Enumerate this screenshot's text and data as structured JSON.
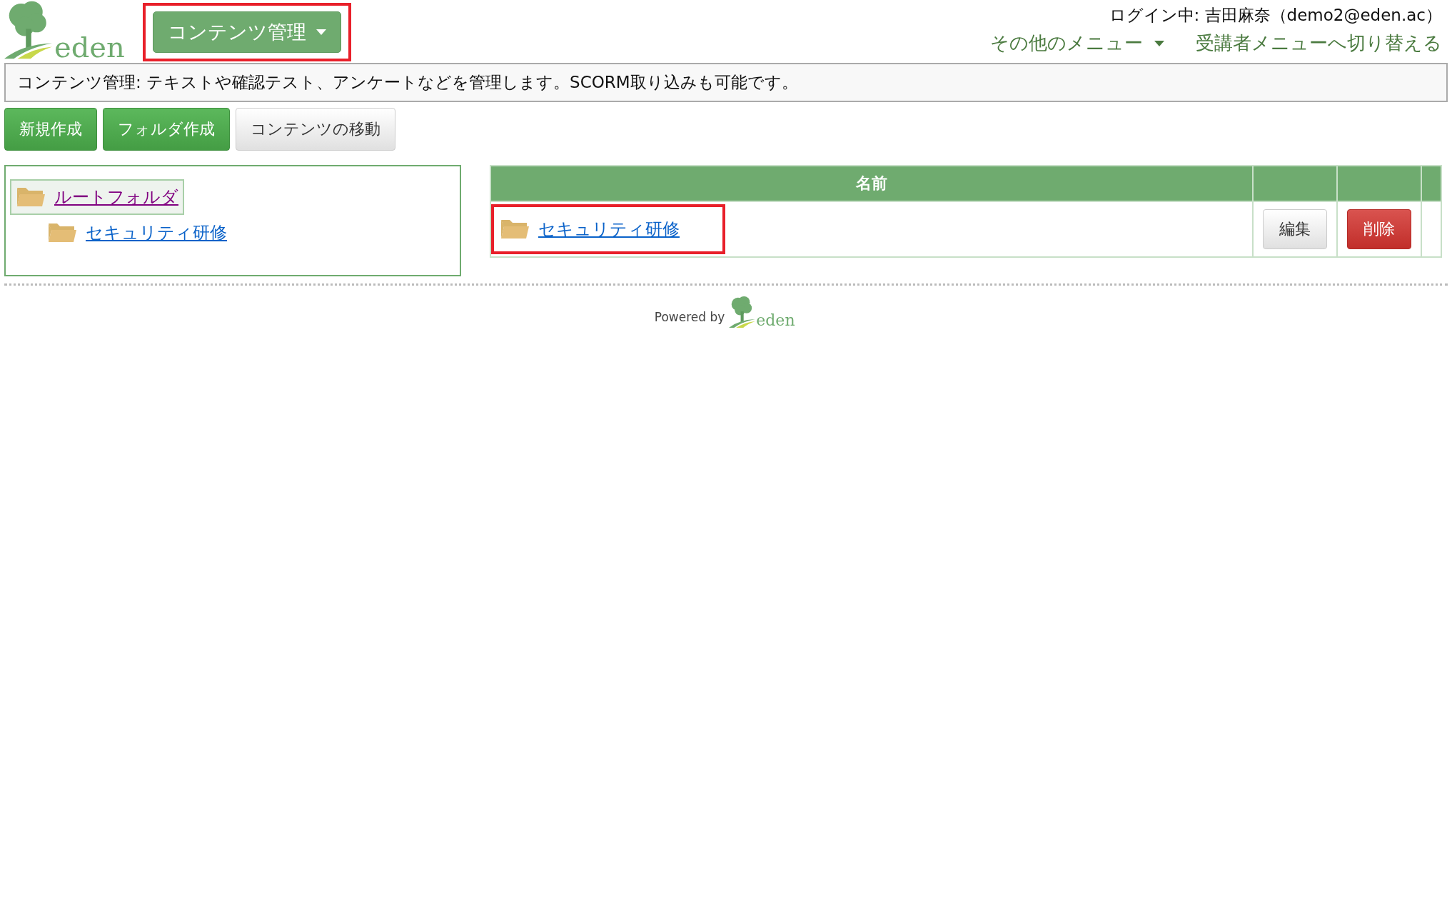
{
  "header": {
    "logo_text": "eden",
    "menu_button": {
      "label": "コンテンツ管理",
      "highlighted": true
    },
    "login": "ログイン中: 吉田麻奈（demo2@eden.ac）",
    "links": [
      {
        "label": "その他のメニュー",
        "dropdown": true
      },
      {
        "label": "受講者メニューへ切り替える",
        "dropdown": false
      }
    ]
  },
  "info": "コンテンツ管理: テキストや確認テスト、アンケートなどを管理します。SCORM取り込みも可能です。",
  "toolbar": [
    {
      "label": "新規作成",
      "kind": "primary"
    },
    {
      "label": "フォルダ作成",
      "kind": "primary"
    },
    {
      "label": "コンテンツの移動",
      "kind": "default"
    }
  ],
  "tree": [
    {
      "label": "ルートフォルダ",
      "selected": true,
      "visited": true,
      "children": [
        {
          "label": "セキュリティ研修",
          "selected": false,
          "visited": false
        }
      ]
    }
  ],
  "table": {
    "columns": [
      "名前",
      "",
      ""
    ],
    "rows": [
      {
        "name": "セキュリティ研修",
        "highlighted": true,
        "actions": [
          {
            "label": "編集",
            "kind": "default"
          },
          {
            "label": "削除",
            "kind": "danger"
          }
        ]
      }
    ]
  },
  "footer": {
    "powered_by": "Powered by",
    "logo_text": "eden"
  }
}
